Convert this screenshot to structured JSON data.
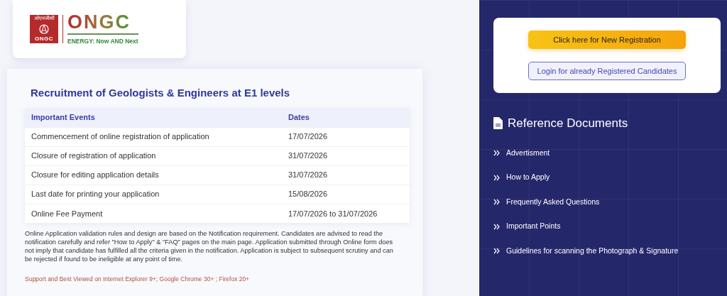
{
  "logo": {
    "emblem_hindi": "ओएनजीसी",
    "emblem_text": "ONGC",
    "wordmark": "ONGC",
    "tagline": "ENERGY: Now AND Next"
  },
  "notice": {
    "title": "Recruitment of Geologists & Engineers at E1 levels",
    "table": {
      "columns": [
        "Important Events",
        "Dates"
      ],
      "rows": [
        [
          "Commencement of online registration of application",
          "17/07/2026"
        ],
        [
          "Closure of registration of application",
          "31/07/2026"
        ],
        [
          "Closure for editing application details",
          "31/07/2026"
        ],
        [
          "Last date for printing your application",
          "15/08/2026"
        ],
        [
          "Online Fee Payment",
          "17/07/2026 to 31/07/2026"
        ]
      ]
    },
    "disclaimer": "Online Application validation rules and design are based on the Notification requirement. Candidates are advised to read the notification carefully and refer \"How to Apply\" & \"FAQ\" pages on the main page. Application submitted through Online form does not imply that candidate has fulfilled all the criteria given in the notification. Application is subject to subsequent scrutiny and can be rejected if found to be ineligible at any point of time.",
    "browser_support": "Support and Best Viewed on Internet Explorer 9+; Google Chrome 30+ ; Firefox 20+"
  },
  "actions": [
    {
      "label": "Click here for New Registration",
      "kind": "primary"
    },
    {
      "label": "Login for already Registered Candidates",
      "kind": "outline"
    }
  ],
  "reference_documents": {
    "title": "Reference Documents",
    "items": [
      "Advertisment",
      "How to Apply",
      "Frequently Asked Questions",
      "Important Points",
      "Guidelines for scanning the Photograph & Signature"
    ]
  }
}
